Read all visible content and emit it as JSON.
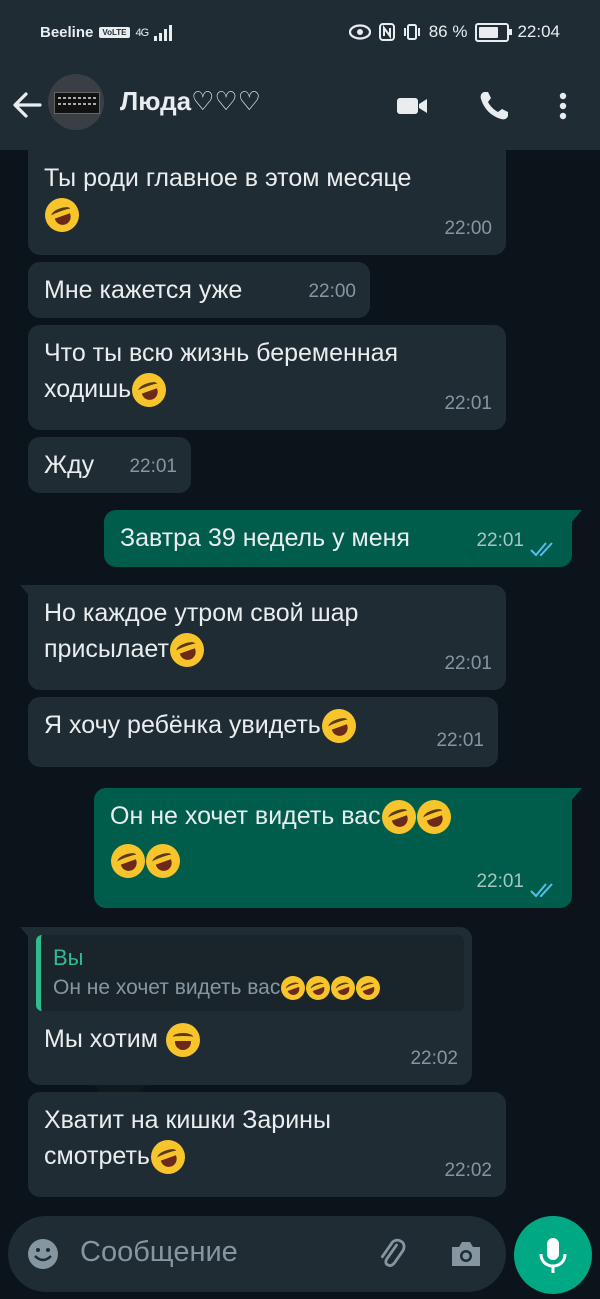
{
  "status_bar": {
    "carrier": "Beeline",
    "network_badge": "VoLTE",
    "network_type": "4G",
    "battery_percent": "86 %",
    "battery_level": 0.86,
    "time": "22:04"
  },
  "header": {
    "contact_name": "Люда♡♡♡",
    "icons": [
      "back-arrow-icon",
      "video-call-icon",
      "voice-call-icon",
      "more-options-icon"
    ]
  },
  "messages": [
    {
      "direction": "in",
      "text": "Ты роди главное в этом месяце",
      "time": "22:00"
    },
    {
      "direction": "in",
      "text": "Мне кажется уже",
      "time": "22:00"
    },
    {
      "direction": "in",
      "text": "Что ты всю жизнь беременная",
      "text2": "ходишь",
      "time": "22:01"
    },
    {
      "direction": "in",
      "text": "Жду",
      "time": "22:01"
    },
    {
      "direction": "out",
      "text": "Завтра 39 недель у меня",
      "time": "22:01"
    },
    {
      "direction": "in",
      "text": "Но каждое утром свой шар",
      "text2": "присылает",
      "time": "22:01"
    },
    {
      "direction": "in",
      "text": "Я хочу ребёнка увидеть",
      "time": "22:01"
    },
    {
      "direction": "out",
      "text": "Он не хочет видеть вас",
      "time": "22:01"
    },
    {
      "direction": "in",
      "quote_author": "Вы",
      "quote_text": "Он не хочет видеть вас",
      "text": "Мы хотим",
      "time": "22:02"
    },
    {
      "direction": "in",
      "text": "Хватит на кишки Зарины",
      "text2": "смотреть",
      "time": "22:02"
    }
  ],
  "composer": {
    "placeholder": "Сообщение"
  },
  "colors": {
    "background": "#0b141a",
    "incoming_bubble": "#202c33",
    "outgoing_bubble": "#005c4b",
    "accent": "#00a884",
    "read_ticks": "#53bdeb"
  }
}
